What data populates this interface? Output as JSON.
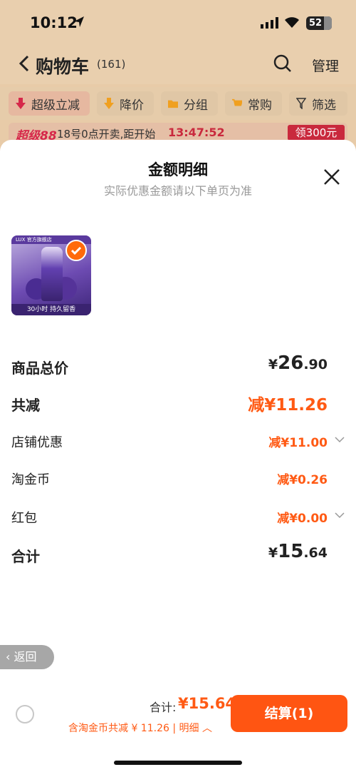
{
  "status": {
    "time": "10:12",
    "battery": "52"
  },
  "header": {
    "title": "购物车",
    "count": "(161)",
    "manage": "管理"
  },
  "chips": [
    {
      "label": "超级立减",
      "icon": "arrow-down-icon"
    },
    {
      "label": "降价",
      "icon": "arrow-down-icon"
    },
    {
      "label": "分组",
      "icon": "folder-icon"
    },
    {
      "label": "常购",
      "icon": "cart-icon"
    },
    {
      "label": "筛选",
      "icon": "filter-icon"
    }
  ],
  "promo": {
    "brand": "超级88",
    "text": "18号0点开卖,距开始",
    "countdown": "13:47:52",
    "coupon": "领300元"
  },
  "sheet": {
    "title": "金额明细",
    "subtitle": "实际优惠金额请以下单页为准",
    "product": {
      "brand": "LUX",
      "shop": "官方旗舰店",
      "tagline": "30小时 持久留香"
    },
    "rows": {
      "total_label": "商品总价",
      "total_currency": "¥",
      "total_int": "26",
      "total_dec": ".90",
      "discount_label": "共减",
      "discount_value": "减¥11.26",
      "shop_label": "店铺优惠",
      "shop_value": "减¥11.00",
      "coin_label": "淘金币",
      "coin_value": "减¥0.26",
      "redpacket_label": "红包",
      "redpacket_value": "减¥0.00",
      "sum_label": "合计",
      "sum_currency": "¥",
      "sum_int": "15",
      "sum_dec": ".64"
    }
  },
  "back_pill": "返回",
  "bottom": {
    "total_label": "合计:",
    "total_value": "¥15.64",
    "sub_text": "含淘金币共减 ¥ 11.26 | 明细",
    "checkout": "结算(1)"
  },
  "colors": {
    "accent": "#ff5512",
    "promo_red": "#c9293d"
  }
}
